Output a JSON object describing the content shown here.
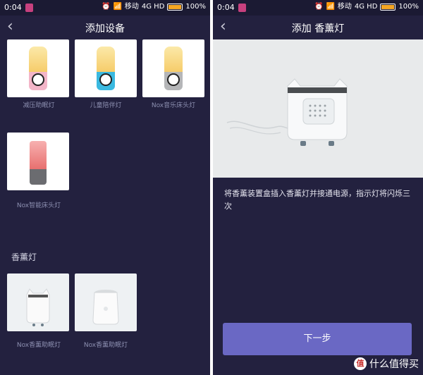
{
  "status_bar": {
    "time": "0:04",
    "carrier": "移动",
    "network": "4G HD",
    "battery": "100%"
  },
  "left_screen": {
    "title": "添加设备",
    "devices": [
      {
        "label": "减压助眠灯"
      },
      {
        "label": "儿童陪伴灯"
      },
      {
        "label": "Nox音乐床头灯"
      },
      {
        "label": "Nox智能床头灯"
      }
    ],
    "section_title": "香薰灯",
    "aroma_devices": [
      {
        "label": "Nox香薰助眠灯"
      },
      {
        "label": "Nox香薰助眠灯"
      }
    ]
  },
  "right_screen": {
    "title": "添加 香薰灯",
    "instruction": "将香薰装置盒插入香薰灯并接通电源，指示灯将闪烁三次",
    "next_button": "下一步"
  },
  "watermark": {
    "text": "什么值得买",
    "logo": "值"
  },
  "icons": {
    "back": "chevron-left-icon",
    "alarm": "alarm-icon",
    "wifi": "wifi-icon",
    "signal": "signal-icon"
  },
  "colors": {
    "background": "#23213f",
    "button": "#6a68c4",
    "muted_label": "#8c8fb0"
  }
}
